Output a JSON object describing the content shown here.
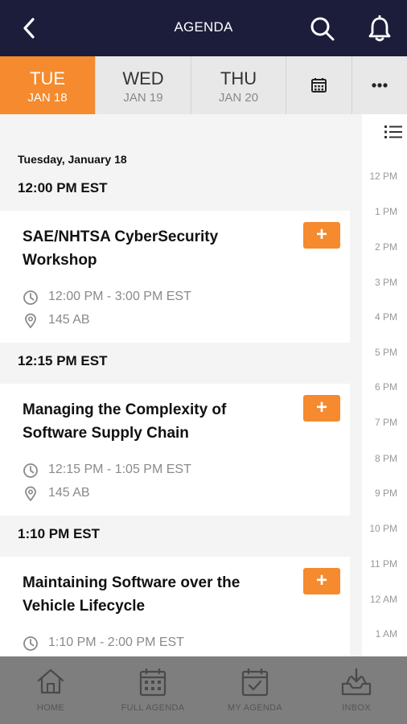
{
  "header": {
    "title": "AGENDA",
    "back_icon": "chevron-left-icon",
    "search_icon": "search-icon",
    "notifications_icon": "bell-icon"
  },
  "day_tabs": [
    {
      "dow": "TUE",
      "date": "JAN 18",
      "active": true
    },
    {
      "dow": "WED",
      "date": "JAN 19",
      "active": false
    },
    {
      "dow": "THU",
      "date": "JAN 20",
      "active": false
    }
  ],
  "tab_icons": {
    "calendar": "calendar-icon",
    "more": "more-dots-icon"
  },
  "agenda": {
    "day_heading": "Tuesday, January 18",
    "groups": [
      {
        "time": "12:00 PM EST",
        "session": {
          "title": "SAE/NHTSA CyberSecurity Workshop",
          "time": "12:00 PM - 3:00 PM EST",
          "location": "145 AB",
          "add": "+"
        }
      },
      {
        "time": "12:15 PM EST",
        "session": {
          "title": "Managing the Complexity of Software Supply Chain",
          "time": "12:15 PM - 1:05 PM EST",
          "location": "145 AB",
          "add": "+"
        }
      },
      {
        "time": "1:10 PM EST",
        "session": {
          "title": "Maintaining Software over the Vehicle Lifecycle",
          "time": "1:10 PM - 2:00 PM EST",
          "location": "",
          "add": "+"
        }
      }
    ]
  },
  "timeline": {
    "list_icon": "list-view-icon",
    "hours": [
      "12 PM",
      "1 PM",
      "2 PM",
      "3 PM",
      "4 PM",
      "5 PM",
      "6 PM",
      "7 PM",
      "8 PM",
      "9 PM",
      "10 PM",
      "11 PM",
      "12 AM",
      "1 AM"
    ]
  },
  "bottom_nav": [
    {
      "label": "HOME",
      "icon": "home-icon"
    },
    {
      "label": "FULL AGENDA",
      "icon": "calendar-grid-icon"
    },
    {
      "label": "MY AGENDA",
      "icon": "calendar-check-icon"
    },
    {
      "label": "INBOX",
      "icon": "inbox-icon"
    }
  ],
  "colors": {
    "header_bg": "#1c1c3b",
    "accent": "#f58a2e",
    "nav_bg": "#7e7e7e"
  }
}
